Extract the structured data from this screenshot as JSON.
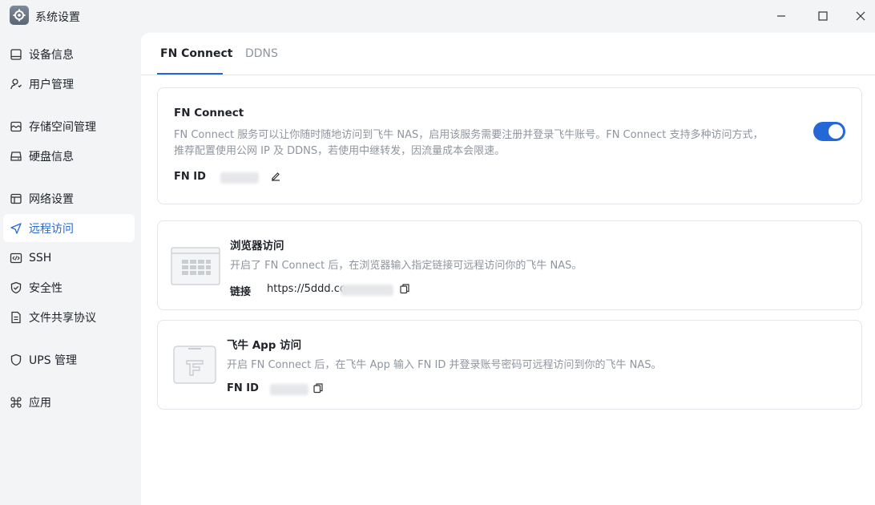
{
  "window": {
    "title": "系统设置"
  },
  "sidebar": {
    "items": [
      {
        "label": "设备信息",
        "icon": "device-icon"
      },
      {
        "label": "用户管理",
        "icon": "user-icon"
      },
      {
        "label": "存储空间管理",
        "icon": "storage-icon"
      },
      {
        "label": "硬盘信息",
        "icon": "disk-icon"
      },
      {
        "label": "网络设置",
        "icon": "network-icon"
      },
      {
        "label": "远程访问",
        "icon": "send-icon",
        "active": true
      },
      {
        "label": "SSH",
        "icon": "code-icon"
      },
      {
        "label": "安全性",
        "icon": "shield-icon"
      },
      {
        "label": "文件共享协议",
        "icon": "file-icon"
      },
      {
        "label": "UPS 管理",
        "icon": "ups-shield-icon"
      },
      {
        "label": "应用",
        "icon": "command-icon"
      }
    ]
  },
  "tabs": [
    {
      "label": "FN Connect",
      "active": true
    },
    {
      "label": "DDNS",
      "active": false
    }
  ],
  "fn_connect": {
    "title": "FN Connect",
    "desc1": "FN Connect 服务可以让你随时随地访问到飞牛 NAS，启用该服务需要注册并登录飞牛账号。FN Connect 支持多种访问方式，",
    "desc2": "推荐配置使用公网 IP 及 DDNS，若使用中继转发，因流量成本会限速。",
    "id_label": "FN ID",
    "enabled": true
  },
  "browser_access": {
    "title": "浏览器访问",
    "desc": "开启了 FN Connect 后，在浏览器输入指定链接可远程访问你的飞牛 NAS。",
    "link_label": "链接",
    "link_value": "https://5ddd.co"
  },
  "app_access": {
    "title": "飞牛 App 访问",
    "desc": "开启 FN Connect 后，在飞牛 App 输入 FN ID 并登录账号密码可远程访问到你的飞牛 NAS。",
    "id_label": "FN ID"
  },
  "colors": {
    "accent": "#2468d8",
    "muted": "#8f959e"
  }
}
